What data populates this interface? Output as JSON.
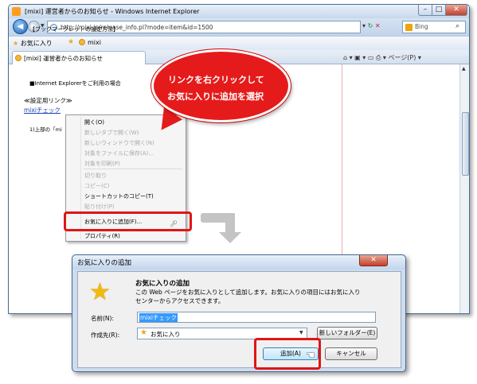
{
  "browser": {
    "title": "[mixi] 運営者からのお知らせ - Windows Internet Explorer",
    "window_controls": {
      "minimize": "–",
      "maximize": "□",
      "close": "✕"
    },
    "url": "http://mixi.jp/release_info.pl?mode=item&id=1500",
    "search_placeholder": "Bing",
    "favorites_label": "お気に入り",
    "favorites_link": "mixi",
    "tab_label": "[mixi] 運営者からのお知らせ",
    "command_bar": "⌂ ▾ ▣ ▾ ▭ ⎙ ▾ ページ(P) ▾"
  },
  "page": {
    "heading_bookmark": "【ブックマークレットの設定方法】",
    "heading_ie": "■Internet Explorerをご利用の場合",
    "settings_link_heading": "≪設定用リンク≫",
    "mixi_link": "mixiチェック",
    "step1": "1)上部の「mi"
  },
  "context_menu": {
    "items": [
      {
        "label": "開く(O)",
        "enabled": true
      },
      {
        "label": "新しいタブで開く(W)",
        "enabled": false
      },
      {
        "label": "新しいウィンドウで開く(N)",
        "enabled": false
      },
      {
        "label": "対象をファイルに保存(A)...",
        "enabled": false
      },
      {
        "label": "対象を印刷(P)",
        "enabled": false
      },
      {
        "label": "切り取り",
        "enabled": false
      },
      {
        "label": "コピー(C)",
        "enabled": false
      },
      {
        "label": "ショートカットのコピー(T)",
        "enabled": true
      },
      {
        "label": "貼り付け(P)",
        "enabled": false
      },
      {
        "label": "お気に入りに追加(F)...",
        "enabled": true
      },
      {
        "label": "プロパティ(R)",
        "enabled": true
      }
    ]
  },
  "callout": {
    "line1": "リンクを右クリックして",
    "line2": "お気に入りに追加を選択"
  },
  "dialog": {
    "title": "お気に入りの追加",
    "close": "✕",
    "heading": "お気に入りの追加",
    "description_line1": "この Web ページをお気に入りとして追加します。お気に入りの項目にはお気に入り",
    "description_line2": "センターからアクセスできます。",
    "name_label": "名前(N):",
    "name_value": "mixiチェック",
    "folder_label": "作成先(R):",
    "folder_value": "お気に入り",
    "new_folder_button": "新しいフォルダー(E)",
    "add_button": "追加(A)",
    "cancel_button": "キャンセル"
  },
  "colors": {
    "highlight": "#e01515",
    "link": "#1a3fb6",
    "accent_blue": "#3399ff"
  }
}
